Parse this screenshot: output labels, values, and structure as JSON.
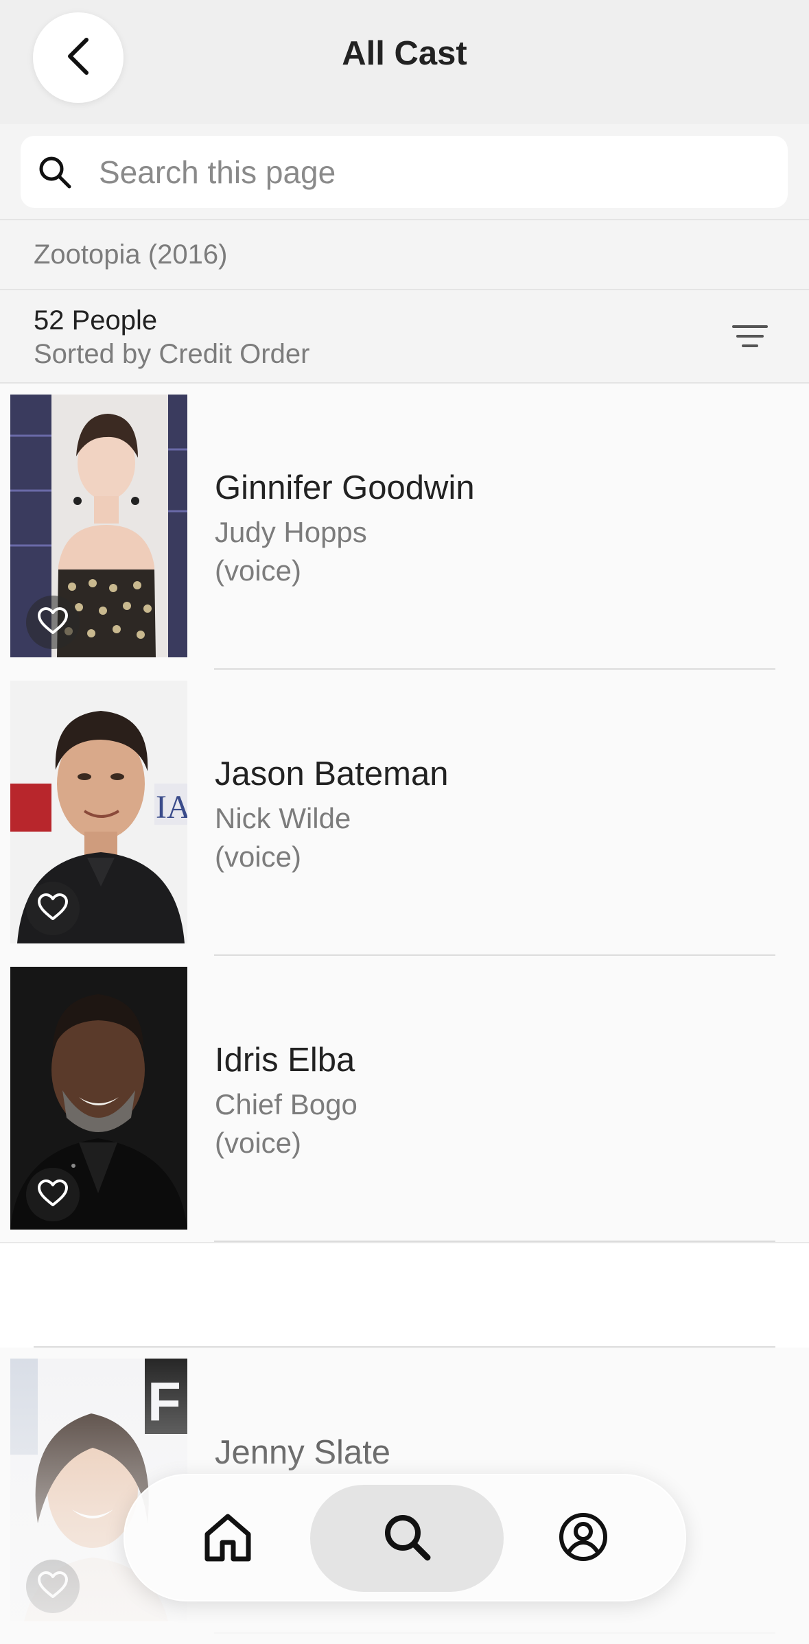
{
  "header": {
    "title": "All Cast"
  },
  "search": {
    "placeholder": "Search this page",
    "value": ""
  },
  "movie": {
    "title": "Zootopia (2016)"
  },
  "summary": {
    "count": "52 People",
    "sort": "Sorted by Credit Order"
  },
  "cast": [
    {
      "name": "Ginnifer Goodwin",
      "role": "Judy Hopps",
      "note": "(voice)"
    },
    {
      "name": "Jason Bateman",
      "role": "Nick Wilde",
      "note": "(voice)"
    },
    {
      "name": "Idris Elba",
      "role": "Chief Bogo",
      "note": "(voice)"
    },
    {
      "name": "Jenny Slate",
      "role": "",
      "note": ""
    }
  ],
  "tabs": [
    {
      "icon": "home-icon"
    },
    {
      "icon": "search-icon",
      "selected": true
    },
    {
      "icon": "profile-icon"
    }
  ],
  "colors": {
    "header_bg": "#efefef",
    "list_bg": "#fafafa",
    "text_primary": "#222222",
    "text_secondary": "#7c7c7c"
  }
}
